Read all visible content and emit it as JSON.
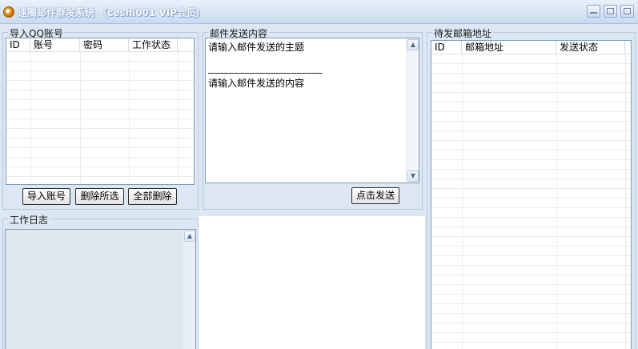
{
  "window": {
    "title": "速腾邮件群发系统 （ceshi001 VIP会员）"
  },
  "import_group": {
    "legend": "导入QQ账号",
    "columns": [
      "ID",
      "账号",
      "密码",
      "工作状态"
    ],
    "buttons": {
      "import": "导入账号",
      "delete_selected": "删除所选",
      "delete_all": "全部删除"
    }
  },
  "mail_group": {
    "legend": "邮件发送内容",
    "subject": "请输入邮件发送的主题",
    "separator": "______________________",
    "content": "请输入邮件发送的内容",
    "send_button": "点击发送"
  },
  "log_group": {
    "legend": "工作日志"
  },
  "addresses_group": {
    "legend": "待发邮箱地址",
    "columns": [
      "ID",
      "邮箱地址",
      "发送状态"
    ]
  },
  "colors": {
    "background": "#dde7f3",
    "border": "#7f9db9"
  }
}
